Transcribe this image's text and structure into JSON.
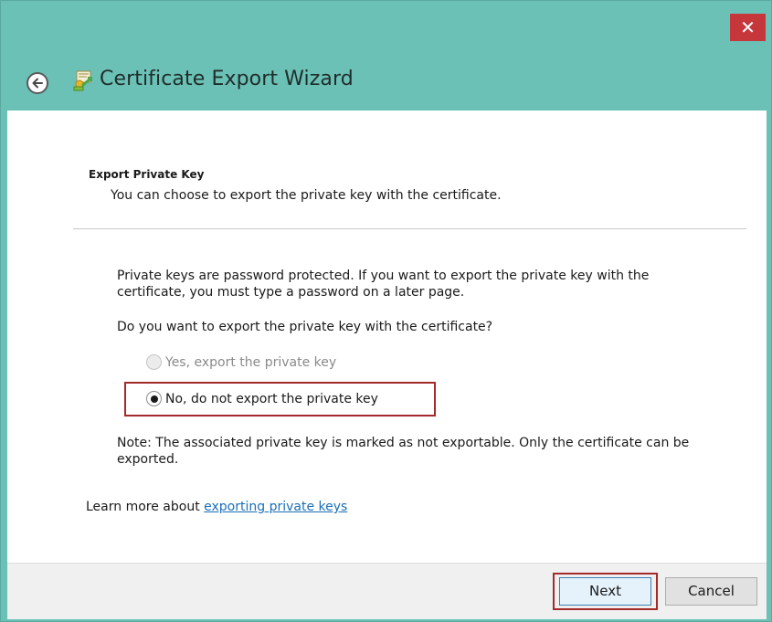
{
  "window": {
    "title": "Certificate Export Wizard",
    "close_glyph": "✕",
    "accent": "#6cc1b6"
  },
  "header": {
    "section_title": "Export Private Key",
    "section_subtitle": "You can choose to export the private key with the certificate."
  },
  "body": {
    "intro": "Private keys are password protected. If you want to export the private key with the certificate, you must type a password on a later page.",
    "question": "Do you want to export the private key with the certificate?",
    "options": [
      {
        "label": "Yes, export the private key",
        "enabled": false,
        "selected": false
      },
      {
        "label": "No, do not export the private key",
        "enabled": true,
        "selected": true
      }
    ],
    "note": "Note: The associated private key is marked as not exportable. Only the certificate can be exported.",
    "learn_prefix": "Learn more about ",
    "learn_link": "exporting private keys"
  },
  "footer": {
    "next_label": "Next",
    "cancel_label": "Cancel"
  },
  "icons": {
    "back": "back-arrow-icon",
    "certificate": "certificate-icon",
    "close": "close-icon"
  }
}
